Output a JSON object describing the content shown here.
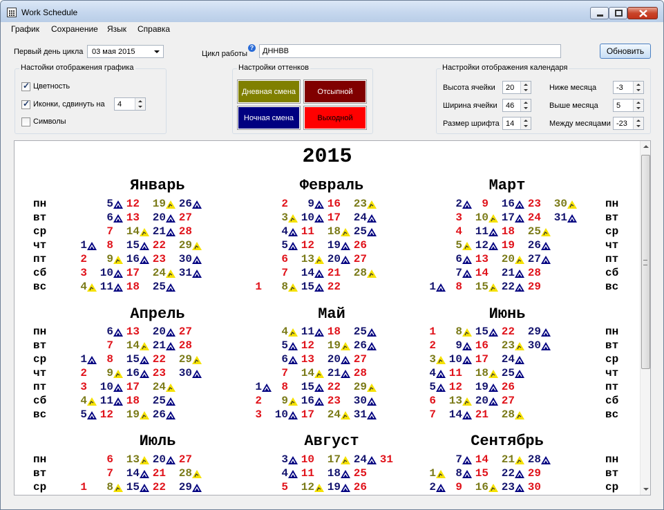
{
  "window": {
    "title": "Work Schedule"
  },
  "menu": [
    "График",
    "Сохранение",
    "Язык",
    "Справка"
  ],
  "controls": {
    "first_day_label": "Первый день цикла",
    "first_day_value": "03 мая 2015",
    "cycle_label": "Цикл работы",
    "cycle_value": "ДННВВ",
    "refresh_label": "Обновить"
  },
  "display_group": {
    "title": "Настойки отображения графика",
    "color_label": "Цветность",
    "color_checked": true,
    "icons_label": "Иконки, сдвинуть на",
    "icons_checked": true,
    "icons_shift": "4",
    "symbols_label": "Символы",
    "symbols_checked": false
  },
  "shades_group": {
    "title": "Настройки оттенков",
    "day_shift": "Дневная смена",
    "sleep_off": "Отсыпной",
    "night_shift": "Ночная смена",
    "day_off": "Выходной",
    "colors": {
      "day": "#808000",
      "sleep": "#800000",
      "night": "#000080",
      "off": "#ff0000"
    }
  },
  "calendar_group": {
    "title": "Настройки отображения календаря",
    "cell_height_label": "Высота ячейки",
    "cell_height": "20",
    "cell_width_label": "Ширина ячейки",
    "cell_width": "46",
    "font_size_label": "Размер шрифта",
    "font_size": "14",
    "below_label": "Ниже месяца",
    "below": "-3",
    "above_label": "Выше месяца",
    "above": "5",
    "between_label": "Между месяцами",
    "between": "-23"
  },
  "calendar": {
    "year": "2015",
    "weekdays": [
      "пн",
      "вт",
      "ср",
      "чт",
      "пт",
      "сб",
      "вс"
    ],
    "shift_colors": {
      "N": "#14146e",
      "D": "#7a7a18",
      "O": "#e0121a",
      "V": "#e0121a"
    },
    "months": [
      {
        "name": "Январь",
        "start": 3,
        "days": 31,
        "phase": 2
      },
      {
        "name": "Февраль",
        "start": 6,
        "days": 28,
        "phase": 3
      },
      {
        "name": "Март",
        "start": 6,
        "days": 31,
        "phase": 1
      },
      {
        "name": "Апрель",
        "start": 2,
        "days": 30,
        "phase": 2
      },
      {
        "name": "Май",
        "start": 4,
        "days": 31,
        "phase": 2
      },
      {
        "name": "Июнь",
        "start": 0,
        "days": 30,
        "phase": 3
      },
      {
        "name": "Июль",
        "start": 2,
        "days": 31,
        "phase": 3
      },
      {
        "name": "Август",
        "start": 5,
        "days": 31,
        "phase": 4
      },
      {
        "name": "Сентябрь",
        "start": 1,
        "days": 30,
        "phase": 0
      }
    ]
  }
}
